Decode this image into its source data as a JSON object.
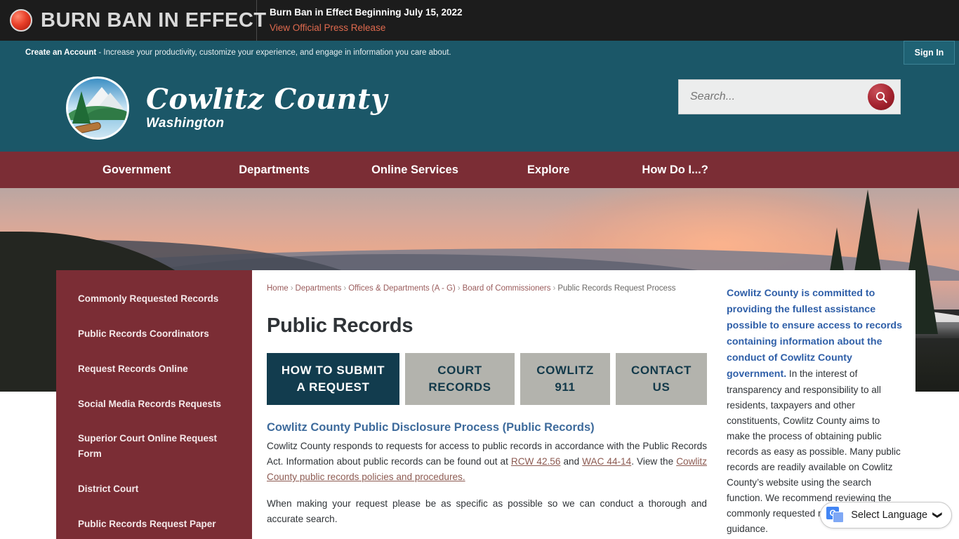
{
  "alert": {
    "banner_title": "BURN BAN IN EFFECT",
    "headline": "Burn Ban in Effect Beginning July 15, 2022",
    "link_label": "View Official Press Release",
    "dot_icon": "red-alert-dot-icon",
    "bg_color": "#1c1c1c",
    "link_color": "#e06a4e"
  },
  "account_strip": {
    "bold_lead": "Create an Account",
    "rest": " - Increase your productivity, customize your experience, and engage in information you care about.",
    "sign_in_label": "Sign In",
    "bg_color": "#1b5768"
  },
  "header": {
    "logo_icon": "cowlitz-county-seal-icon",
    "title": "Cowlitz County",
    "subtitle": "Washington",
    "search": {
      "placeholder": "Search...",
      "value": "",
      "button_icon": "search-icon",
      "button_color": "#a4232f"
    }
  },
  "nav": {
    "bg_color": "#7b2d35",
    "items": [
      {
        "label": "Government"
      },
      {
        "label": "Departments"
      },
      {
        "label": "Online Services"
      },
      {
        "label": "Explore"
      },
      {
        "label": "How Do I...?"
      }
    ]
  },
  "hero": {
    "description": "sunset-mountain-valley-fog-photo"
  },
  "sidebar": {
    "bg_color": "#7b2d35",
    "items": [
      {
        "label": "Commonly Requested Records"
      },
      {
        "label": "Public Records Coordinators"
      },
      {
        "label": "Request Records Online"
      },
      {
        "label": "Social Media Records Requests"
      },
      {
        "label": "Superior Court Online Request Form"
      },
      {
        "label": "District Court"
      },
      {
        "label": "Public Records Request Paper"
      }
    ]
  },
  "breadcrumb": {
    "items": [
      {
        "label": "Home",
        "current": false
      },
      {
        "label": "Departments",
        "current": false
      },
      {
        "label": "Offices & Departments (A - G)",
        "current": false
      },
      {
        "label": "Board of Commissioners",
        "current": false
      },
      {
        "label": "Public Records Request Process",
        "current": true
      }
    ],
    "separator": "›"
  },
  "main": {
    "page_title": "Public Records",
    "tabs": [
      {
        "label": "HOW TO SUBMIT A REQUEST",
        "active": true
      },
      {
        "label": "COURT RECORDS",
        "active": false
      },
      {
        "label": "COWLITZ 911",
        "active": false
      },
      {
        "label": "CONTACT US",
        "active": false
      }
    ],
    "active_tab_color": "#123c4e",
    "inactive_tab_color": "#b3b3ad",
    "section_heading": "Cowlitz County Public Disclosure Process (Public Records)",
    "paragraph_1_part_1": "Cowlitz County responds to requests for access to public records in accordance with the Public Records Act.  Information about public records can be found out at ",
    "link_rcw": "RCW 42.56",
    "paragraph_1_part_2": " and ",
    "link_wac": "WAC 44-14",
    "paragraph_1_part_3": ".  View the ",
    "link_policies": "Cowlitz County public records policies and procedures.",
    "paragraph_2": "When making your request please be as specific as possible so we can conduct a thorough and accurate search."
  },
  "aside": {
    "bold_lead": "Cowlitz County is committed to providing the fullest assistance possible to ensure access to records containing information about the conduct of Cowlitz County government.",
    "body": " In the interest of transparency and responsibility to all residents, taxpayers and other constituents, Cowlitz County aims to make the process of obtaining public records as easy as possible. Many public records are readily available on Cowlitz County’s website using the search function.  We recommend reviewing the commonly requested records below for guidance."
  },
  "translate_widget": {
    "icon": "google-translate-icon",
    "label": "Select Language",
    "chevron": "⌄"
  }
}
